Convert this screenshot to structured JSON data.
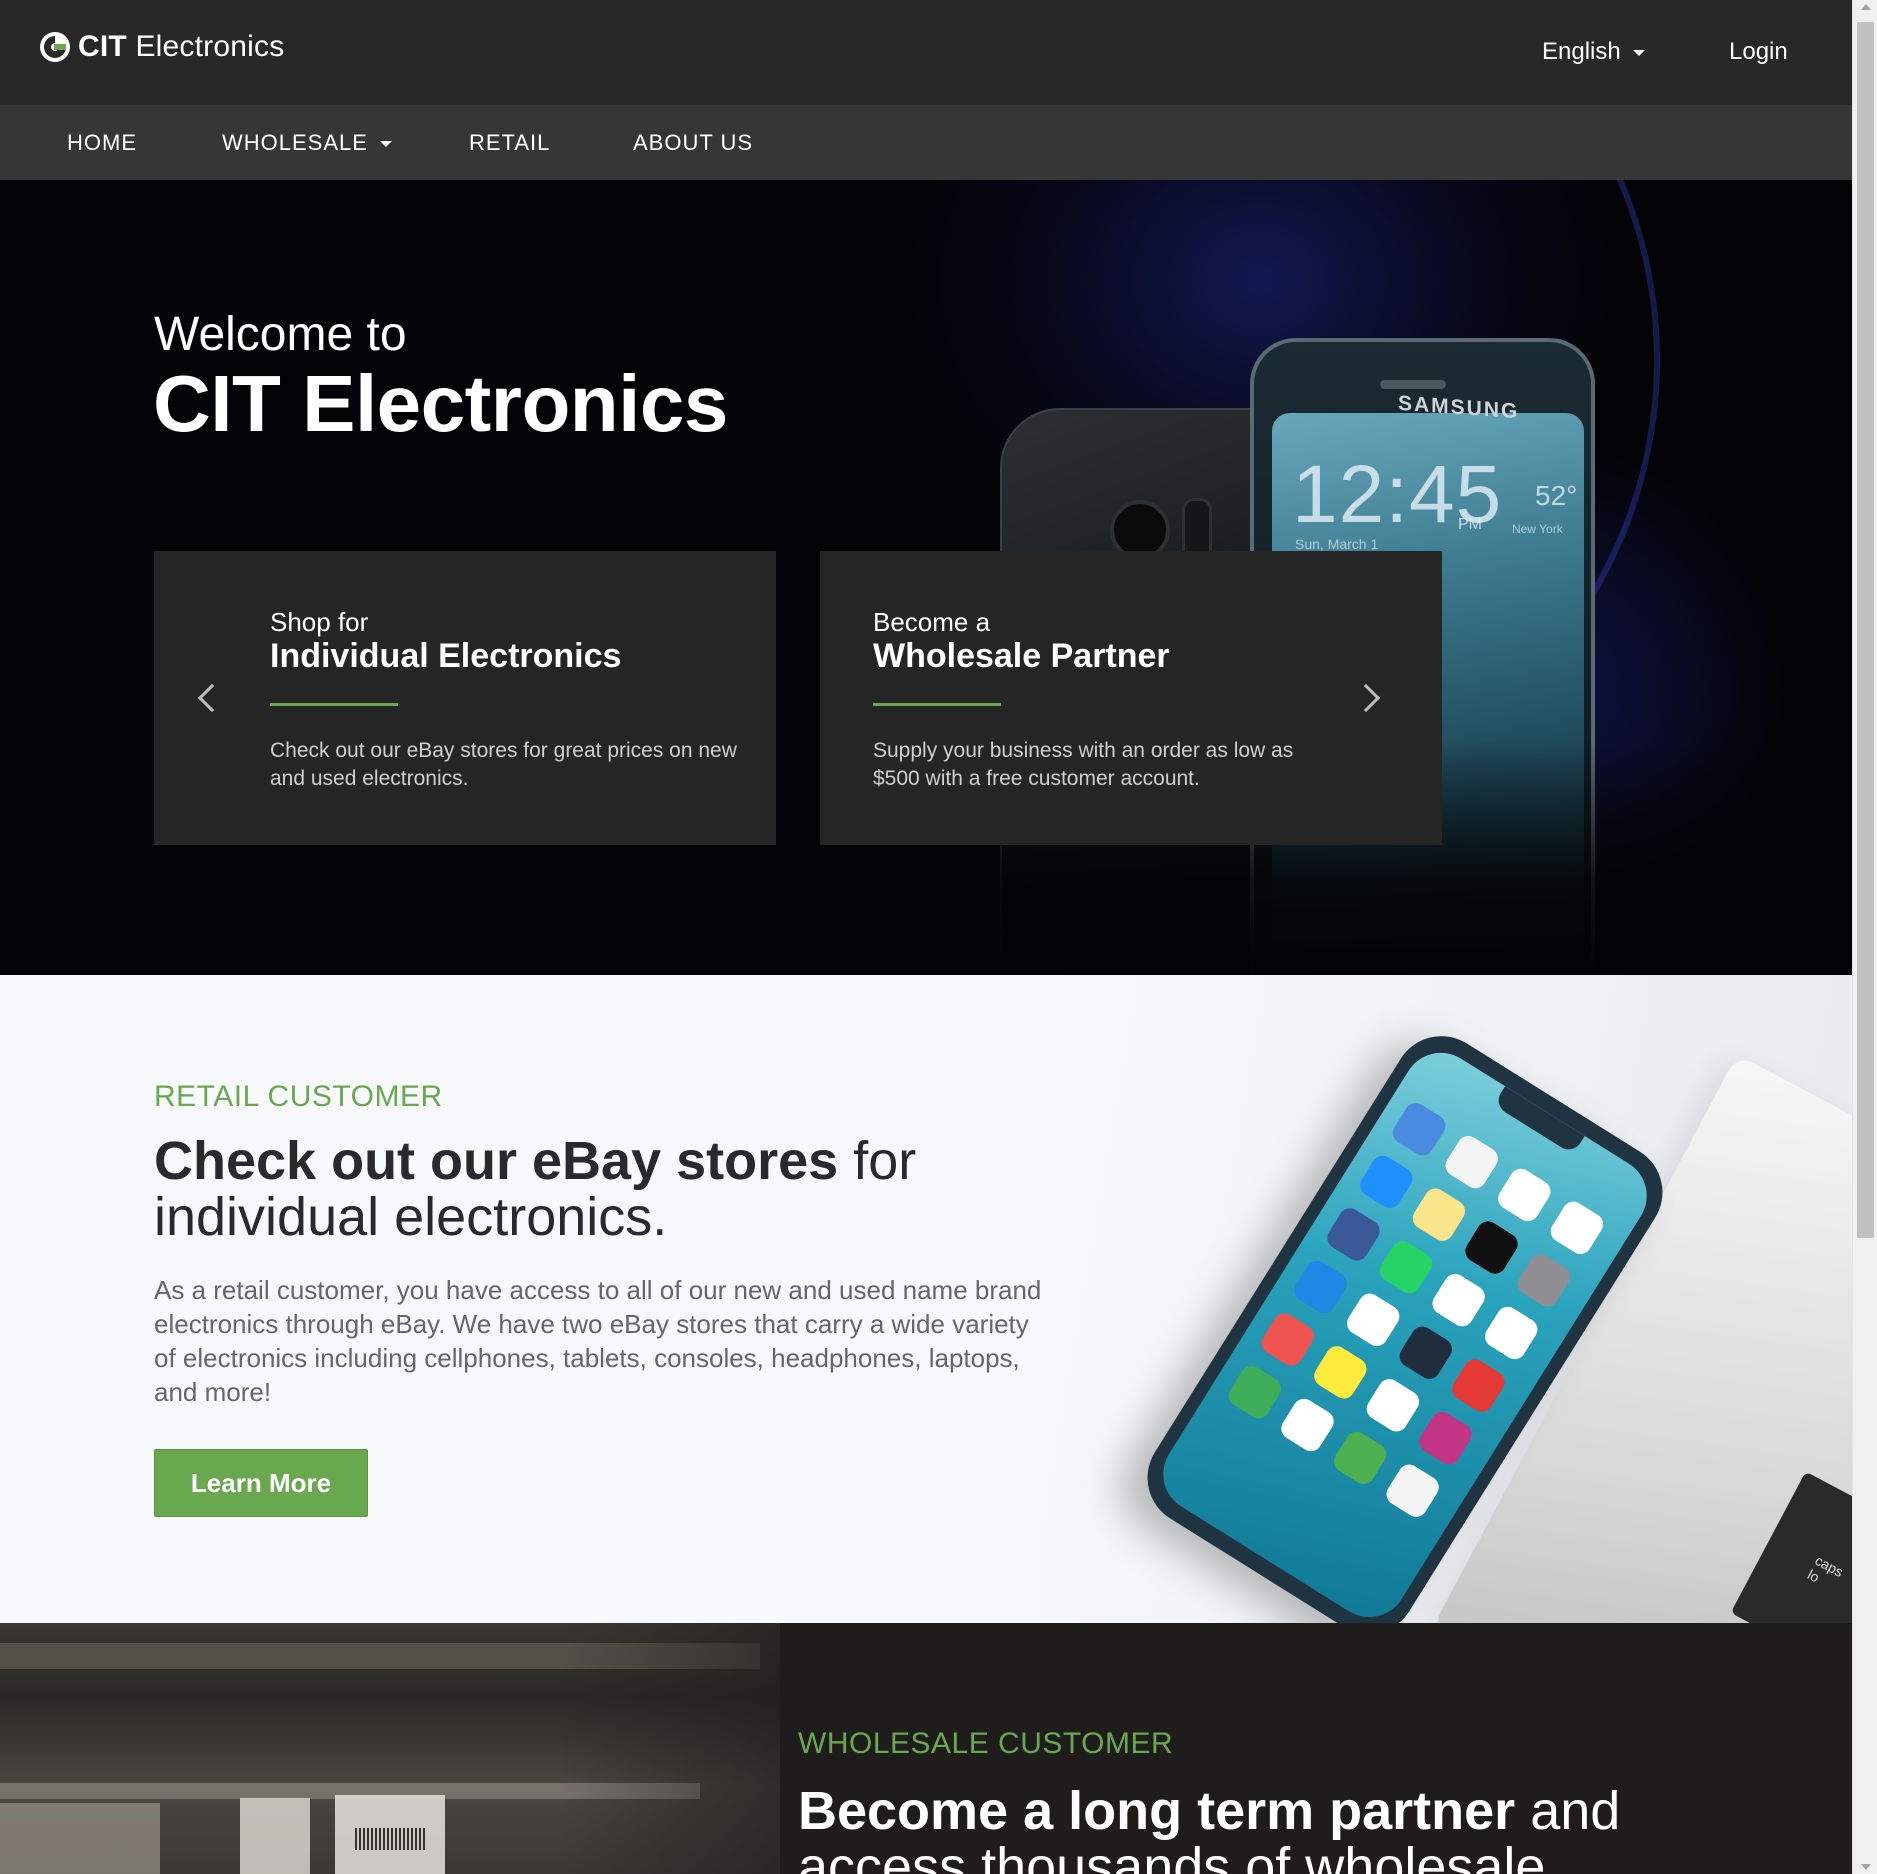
{
  "header": {
    "logo_text_bold": "CIT",
    "logo_text_rest": " Electronics",
    "language": "English",
    "login": "Login"
  },
  "nav": {
    "items": [
      {
        "label": "HOME"
      },
      {
        "label": "WHOLESALE"
      },
      {
        "label": "RETAIL"
      },
      {
        "label": "ABOUT US"
      }
    ]
  },
  "hero": {
    "welcome": "Welcome to",
    "title": "CIT Electronics",
    "phone_brand": "SAMSUNG",
    "phone_time": "12:45",
    "phone_ampm": "PM",
    "phone_date": "Sun, March 1",
    "phone_temp": "52°",
    "phone_location": "New York",
    "cards": [
      {
        "pre": "Shop for",
        "main": "Individual Electronics",
        "desc": "Check out our eBay stores for great prices on new and used electronics."
      },
      {
        "pre": "Become a",
        "main": "Wholesale Partner",
        "desc": "Supply your business with an order as low as $500 with a free customer account."
      }
    ]
  },
  "retail": {
    "eyebrow": "RETAIL CUSTOMER",
    "heading_bold": "Check out our eBay stores",
    "heading_rest": " for individual electronics.",
    "paragraph": "As a retail customer, you have access to all of our new and used name brand electronics through eBay. We have two eBay stores that carry a wide variety of electronics including cellphones, tablets, consoles, headphones, laptops, and more!",
    "button": "Learn More",
    "laptop_key": "caps lo"
  },
  "wholesale": {
    "eyebrow": "WHOLESALE CUSTOMER",
    "heading_bold": "Become a long term partner",
    "heading_rest": " and access thousands of wholesale"
  },
  "colors": {
    "accent_green": "#6aa84f",
    "topbar": "#282828",
    "navbar": "#363636",
    "card": "#252525"
  }
}
